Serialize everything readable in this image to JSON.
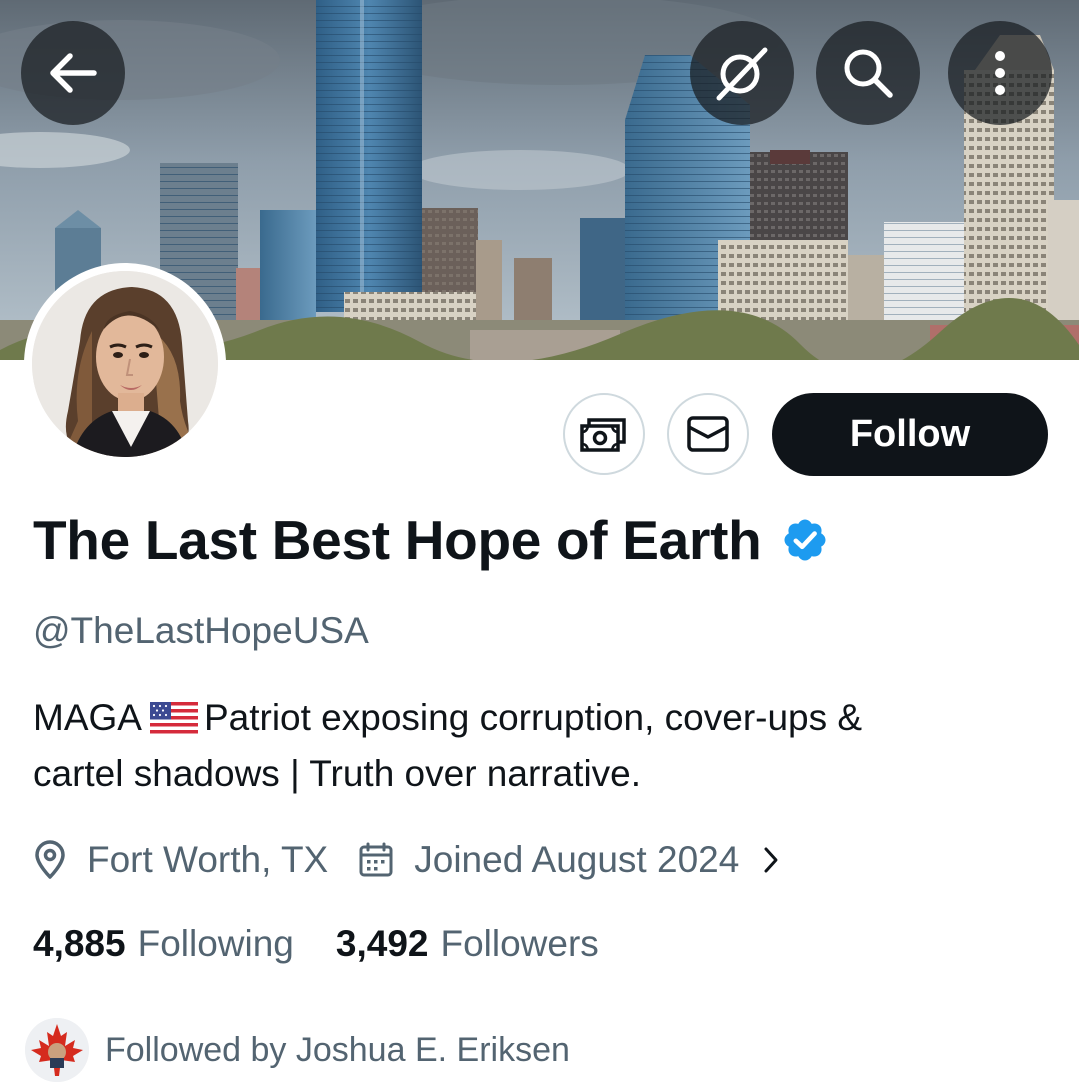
{
  "profile": {
    "display_name": "The Last Best Hope of Earth",
    "handle": "@TheLastHopeUSA",
    "bio_line1_before_flag": "MAGA",
    "bio_flag": "us-flag-emoji",
    "bio_line1_after_flag": "Patriot exposing corruption, cover-ups &",
    "bio_line2": "cartel shadows | Truth over narrative.",
    "location": "Fort Worth, TX",
    "joined": "Joined August 2024",
    "following_count": "4,885",
    "following_label": "Following",
    "followers_count": "3,492",
    "followers_label": "Followers",
    "followed_by": "Followed by Joshua E. Eriksen"
  },
  "actions": {
    "follow_label": "Follow"
  },
  "icons": {
    "back": "arrow-left-icon",
    "grok": "grok-icon",
    "search": "search-icon",
    "more": "more-vertical-icon",
    "subscribe": "subscribe-money-icon",
    "message": "envelope-icon",
    "verified": "verified-badge-icon",
    "location": "location-pin-icon",
    "calendar": "calendar-icon",
    "chevron": "chevron-right-icon"
  },
  "colors": {
    "text_primary": "#0f1419",
    "text_secondary": "#536471",
    "verified_blue": "#1d9bf0",
    "follow_button_bg": "#0f1419",
    "button_border": "#cfd9de"
  }
}
